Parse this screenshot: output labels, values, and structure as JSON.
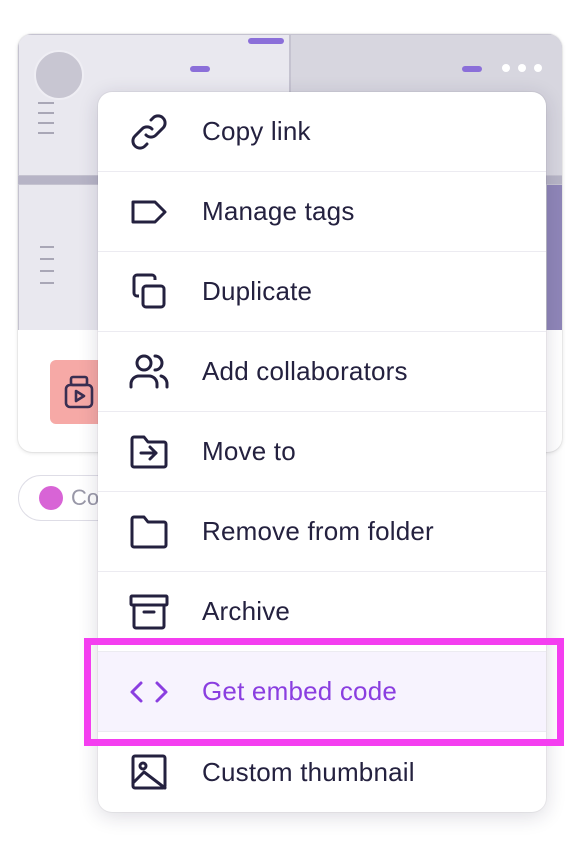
{
  "card": {
    "tag_chip_label": "Co"
  },
  "menu": {
    "items": [
      {
        "label": "Copy link",
        "icon": "link-icon"
      },
      {
        "label": "Manage tags",
        "icon": "tag-icon"
      },
      {
        "label": "Duplicate",
        "icon": "duplicate-icon"
      },
      {
        "label": "Add collaborators",
        "icon": "users-icon"
      },
      {
        "label": "Move to",
        "icon": "folder-move-icon"
      },
      {
        "label": "Remove from folder",
        "icon": "folder-icon"
      },
      {
        "label": "Archive",
        "icon": "archive-icon"
      },
      {
        "label": "Get embed code",
        "icon": "code-icon",
        "active": true
      },
      {
        "label": "Custom thumbnail",
        "icon": "image-icon"
      }
    ]
  },
  "colors": {
    "accent": "#8a3ee0",
    "highlight": "#f43ef0",
    "text": "#24213f",
    "tag_dot": "#d864d6",
    "thumbnail_badge": "#f6a9a6"
  }
}
